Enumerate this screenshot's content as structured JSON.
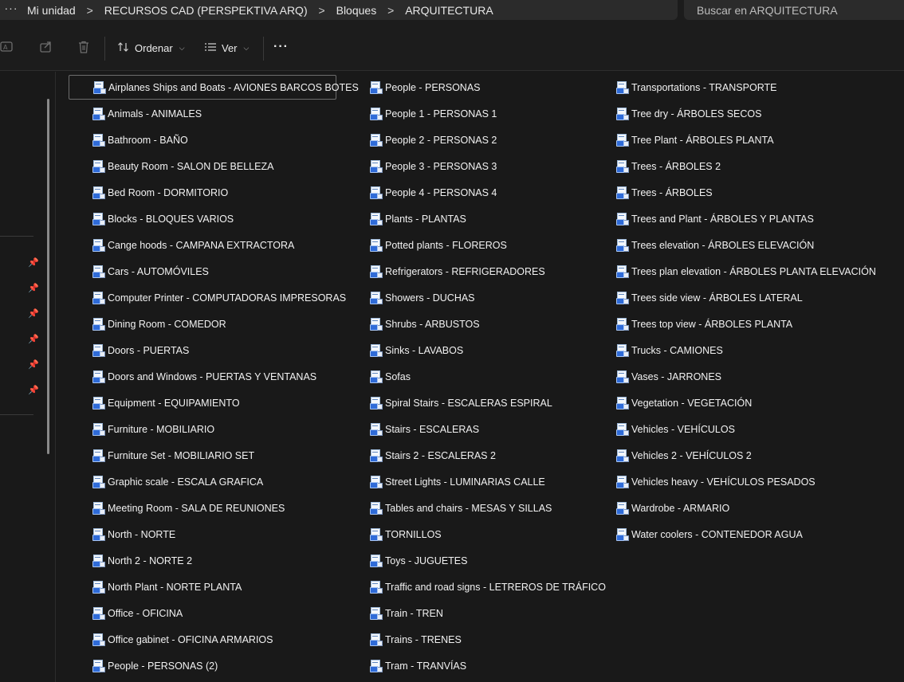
{
  "address_bar": {
    "overflow": "···",
    "crumbs": [
      "Mi unidad",
      "RECURSOS CAD (PERSPEKTIVA ARQ)",
      "Bloques",
      "ARQUITECTURA"
    ],
    "separator": ">"
  },
  "search": {
    "placeholder": "Buscar en ARQUITECTURA"
  },
  "toolbar": {
    "sort_label": "Ordenar",
    "view_label": "Ver",
    "more_label": "···",
    "icons": [
      "rename-icon",
      "share-icon",
      "delete-icon",
      "sort-icon",
      "view-icon"
    ]
  },
  "files": {
    "column1": [
      "Airplanes Ships and Boats -  AVIONES BARCOS BOTES",
      "Animals - ANIMALES",
      "Bathroom - BAÑO",
      "Beauty Room - SALON DE BELLEZA",
      "Bed Room - DORMITORIO",
      "Blocks - BLOQUES VARIOS",
      "Cange hoods - CAMPANA EXTRACTORA",
      "Cars - AUTOMÓVILES",
      "Computer Printer - COMPUTADORAS IMPRESORAS",
      "Dining Room - COMEDOR",
      "Doors - PUERTAS",
      "Doors and Windows - PUERTAS Y VENTANAS",
      "Equipment - EQUIPAMIENTO",
      "Furniture - MOBILIARIO",
      "Furniture Set - MOBILIARIO SET",
      "Graphic scale - ESCALA GRAFICA",
      "Meeting Room - SALA DE REUNIONES",
      "North - NORTE",
      "North 2 - NORTE 2",
      "North Plant - NORTE PLANTA",
      "Office - OFICINA",
      "Office gabinet - OFICINA ARMARIOS",
      "People - PERSONAS (2)"
    ],
    "column2": [
      "People - PERSONAS",
      "People 1 - PERSONAS 1",
      "People 2 - PERSONAS 2",
      "People 3 - PERSONAS 3",
      "People 4 - PERSONAS 4",
      "Plants - PLANTAS",
      "Potted plants - FLOREROS",
      "Refrigerators - REFRIGERADORES",
      "Showers - DUCHAS",
      "Shrubs - ARBUSTOS",
      "Sinks - LAVABOS",
      "Sofas",
      "Spiral Stairs - ESCALERAS ESPIRAL",
      "Stairs - ESCALERAS",
      "Stairs 2 - ESCALERAS 2",
      "Street Lights - LUMINARIAS CALLE",
      "Tables and chairs - MESAS Y SILLAS",
      "TORNILLOS",
      "Toys - JUGUETES",
      "Traffic and road signs - LETREROS DE TRÁFICO",
      "Train - TREN",
      "Trains - TRENES",
      "Tram - TRANVÍAS"
    ],
    "column3": [
      "Transportations - TRANSPORTE",
      "Tree dry - ÁRBOLES SECOS",
      "Tree Plant - ÁRBOLES PLANTA",
      "Trees - ÁRBOLES 2",
      "Trees - ÁRBOLES",
      "Trees and Plant - ÁRBOLES Y PLANTAS",
      "Trees elevation - ÁRBOLES ELEVACIÓN",
      "Trees plan elevation - ÁRBOLES PLANTA ELEVACIÓN",
      "Trees side view - ÁRBOLES LATERAL",
      "Trees top view - ÁRBOLES PLANTA",
      "Trucks - CAMIONES",
      "Vases - JARRONES",
      "Vegetation - VEGETACIÓN",
      "Vehicles - VEHÍCULOS",
      "Vehicles 2 - VEHÍCULOS 2",
      "Vehicles heavy - VEHÍCULOS PESADOS",
      "Wardrobe - ARMARIO",
      "Water coolers - CONTENEDOR AGUA"
    ],
    "selected": "Airplanes Ships and Boats -  AVIONES BARCOS BOTES"
  },
  "nav": {
    "pinned_count": 6
  }
}
